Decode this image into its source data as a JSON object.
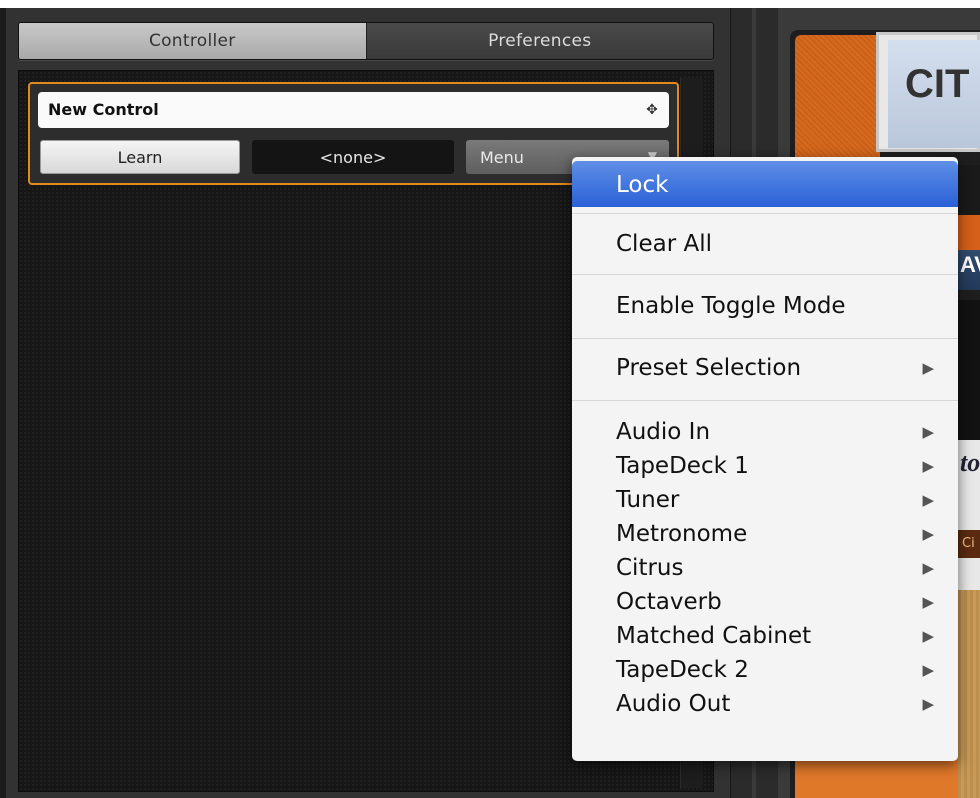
{
  "tabs": {
    "controller": "Controller",
    "preferences": "Preferences"
  },
  "control": {
    "name": "New Control",
    "learn_label": "Learn",
    "assigned_value": "<none>",
    "menu_label": "Menu"
  },
  "context_menu": {
    "lock": "Lock",
    "clear_all": "Clear All",
    "enable_toggle_mode": "Enable Toggle Mode",
    "preset_selection": "Preset Selection",
    "modules": [
      "Audio In",
      "TapeDeck 1",
      "Tuner",
      "Metronome",
      "Citrus",
      "Octaverb",
      "Matched Cabinet",
      "TapeDeck 2",
      "Audio Out"
    ]
  },
  "rack": {
    "amp_label": "CIT",
    "row_text_1": "AV",
    "row_text_2": "to",
    "row_text_3": "Ci"
  },
  "colors": {
    "selection_highlight": "#3b71dc",
    "control_border": "#e08a1e"
  }
}
